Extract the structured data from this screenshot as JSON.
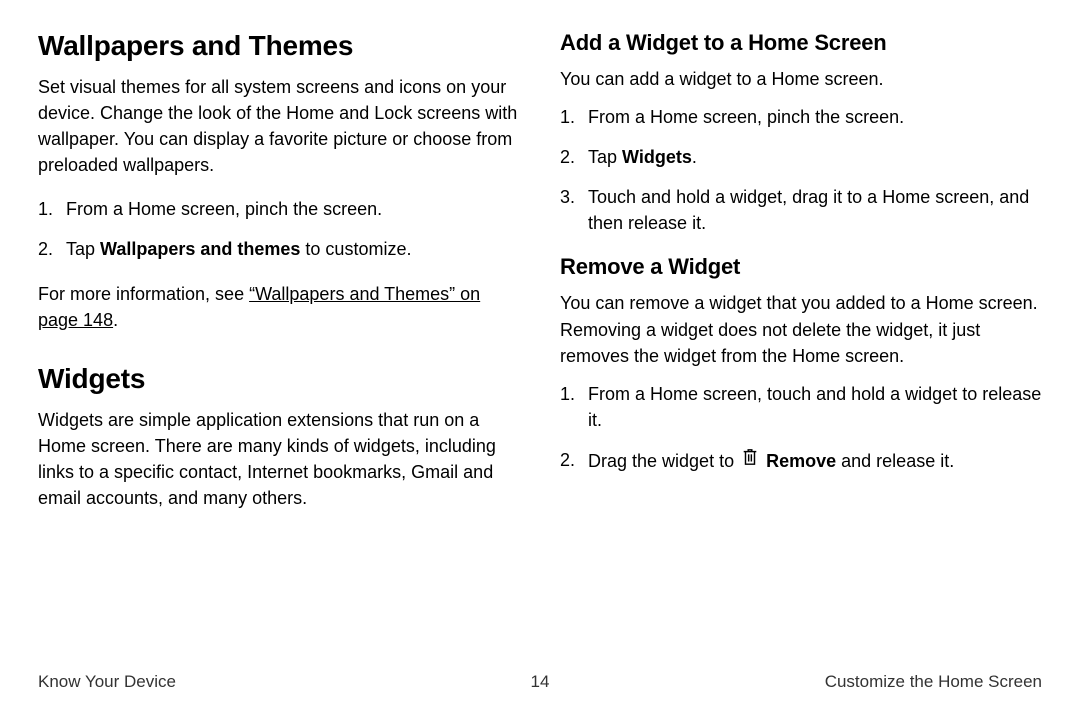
{
  "left": {
    "section1": {
      "title": "Wallpapers and Themes",
      "intro": "Set visual themes for all system screens and icons on your device. Change the look of the Home and Lock screens with wallpaper. You can display a favorite picture or choose from preloaded wallpapers.",
      "step1": "From a Home screen, pinch the screen.",
      "step2_pre": "Tap ",
      "step2_bold": "Wallpapers and themes",
      "step2_post": " to customize.",
      "more_pre": "For more information, see ",
      "more_link": "“Wallpapers and Themes” on page 148",
      "more_post": "."
    },
    "section2": {
      "title": "Widgets",
      "intro": "Widgets are simple application extensions that run on a Home screen. There are many kinds of widgets, including links to a specific contact, Internet bookmarks, Gmail and email accounts, and many others."
    }
  },
  "right": {
    "sub1": {
      "title": "Add a Widget to a Home Screen",
      "intro": "You can add a widget to a Home screen.",
      "step1": "From a Home screen, pinch the screen.",
      "step2_pre": "Tap ",
      "step2_bold": "Widgets",
      "step2_post": ".",
      "step3": "Touch and hold a widget, drag it to a Home screen, and then release it."
    },
    "sub2": {
      "title": "Remove a Widget",
      "intro": "You can remove a widget that you added to a Home screen. Removing a widget does not delete the widget, it just removes the widget from the Home screen.",
      "step1": "From a Home screen, touch and hold a widget to release it.",
      "step2_pre": "Drag the widget to ",
      "step2_bold": "Remove",
      "step2_post": " and release it."
    }
  },
  "footer": {
    "left": "Know Your Device",
    "center": "14",
    "right": "Customize the Home Screen"
  }
}
